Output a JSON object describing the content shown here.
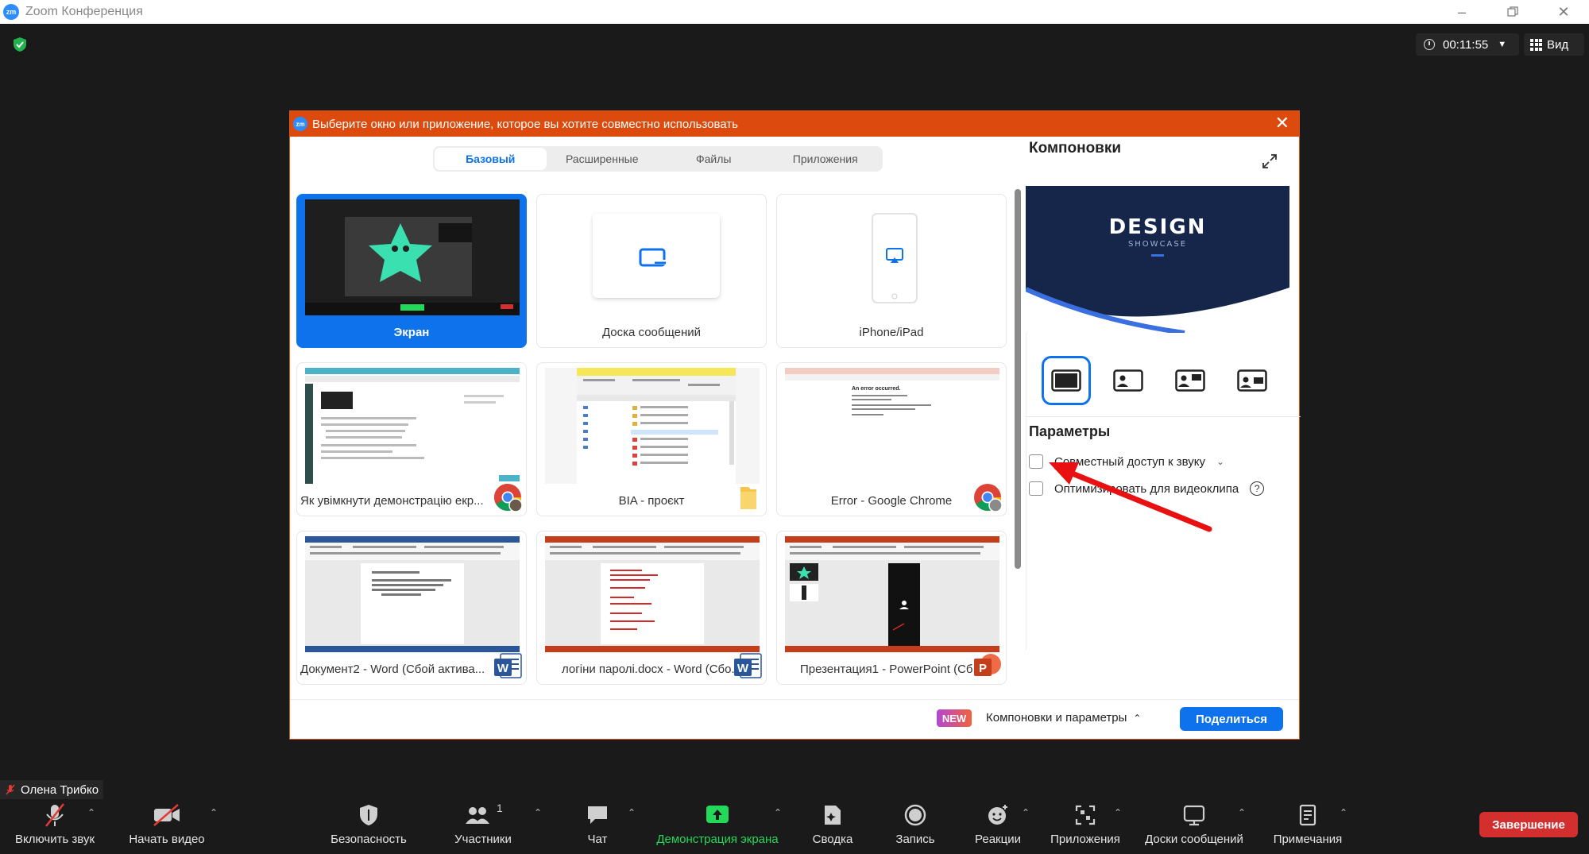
{
  "window": {
    "app_logo": "zm",
    "title": "Zoom Конференция"
  },
  "status": {
    "timer": "00:11:55",
    "view_label": "Вид"
  },
  "dialog": {
    "logo": "zm",
    "title": "Выберите окно или приложение, которое вы хотите совместно использовать",
    "tabs": [
      {
        "label": "Базовый",
        "active": true
      },
      {
        "label": "Расширенные"
      },
      {
        "label": "Файлы"
      },
      {
        "label": "Приложения"
      }
    ],
    "tiles": [
      {
        "label": "Экран",
        "selected": true
      },
      {
        "label": "Доска сообщений"
      },
      {
        "label": "iPhone/iPad"
      },
      {
        "label": "Як увімкнути демонстрацію екр...",
        "app": "chrome-icon"
      },
      {
        "label": "BIA - проєкт",
        "app": "folder-icon"
      },
      {
        "label": "Error - Google Chrome",
        "app": "chrome-icon"
      },
      {
        "label": "Документ2 - Word (Сбой актива...",
        "app": "word-icon"
      },
      {
        "label": "логіни паролі.docx - Word (Сбо...",
        "app": "word-icon"
      },
      {
        "label": "Презентация1 - PowerPoint (Сб...",
        "app": "powerpoint-icon"
      }
    ],
    "thumbnail_text": {
      "error_heading": "An error occurred.",
      "design_logo": "DESIGN",
      "design_sub": "SHOWCASE"
    },
    "layouts_title": "Компоновки",
    "params_title": "Параметры",
    "options": [
      {
        "label": "Совместный доступ к звуку",
        "checked": false
      },
      {
        "label": "Оптимизировать для видеоклипа",
        "checked": false
      }
    ],
    "help_glyph": "?",
    "new_badge": "NEW",
    "footer_link": "Компоновки и параметры",
    "share_button": "Поделиться"
  },
  "participant_name": "Олена Трибко",
  "toolbar": {
    "items": [
      {
        "label": "Включить звук",
        "icon": "mic-muted-icon"
      },
      {
        "label": "Начать видео",
        "icon": "video-off-icon"
      },
      {
        "label": "Безопасность",
        "icon": "shield-icon"
      },
      {
        "label": "Участники",
        "icon": "participants-icon",
        "count": "1"
      },
      {
        "label": "Чат",
        "icon": "chat-icon"
      },
      {
        "label": "Демонстрация экрана",
        "icon": "share-screen-icon"
      },
      {
        "label": "Сводка",
        "icon": "summary-icon"
      },
      {
        "label": "Запись",
        "icon": "record-icon"
      },
      {
        "label": "Реакции",
        "icon": "reactions-icon"
      },
      {
        "label": "Приложения",
        "icon": "apps-icon"
      },
      {
        "label": "Доски сообщений",
        "icon": "whiteboard-icon"
      },
      {
        "label": "Примечания",
        "icon": "notes-icon"
      }
    ],
    "end_button": "Завершение"
  },
  "colors": {
    "accent": "#0e72ed",
    "title_bar": "#dd4a0d",
    "share_green": "#23d959",
    "end_red": "#d32f2f",
    "annotation_arrow": "#e81010"
  }
}
